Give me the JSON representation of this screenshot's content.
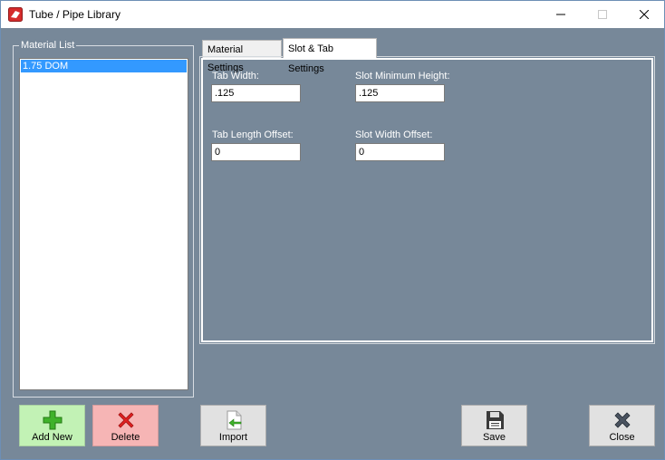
{
  "window": {
    "title": "Tube / Pipe  Library"
  },
  "material_list": {
    "group_label": "Material List",
    "items": [
      "1.75 DOM"
    ],
    "selected_index": 0
  },
  "tabs": [
    {
      "label": "Material Settings",
      "active": false
    },
    {
      "label": "Slot & Tab Settings",
      "active": true
    }
  ],
  "slot_tab_settings": {
    "tab_width": {
      "label": "Tab Width:",
      "value": ".125"
    },
    "slot_min_height": {
      "label": "Slot Minimum Height:",
      "value": ".125"
    },
    "tab_length_offset": {
      "label": "Tab Length Offset:",
      "value": "0"
    },
    "slot_width_offset": {
      "label": "Slot Width Offset:",
      "value": "0"
    }
  },
  "buttons": {
    "add_new": "Add New",
    "delete": "Delete",
    "import": "Import",
    "save": "Save",
    "close": "Close"
  },
  "icons": {
    "app": "app-icon",
    "add": "plus-icon",
    "delete": "x-icon",
    "import": "import-icon",
    "save": "floppy-disk-icon",
    "close": "close-icon"
  },
  "colors": {
    "background": "#778899",
    "selection": "#3399ff",
    "add_button": "#c2f2b5",
    "delete_button": "#f6b5b5"
  }
}
